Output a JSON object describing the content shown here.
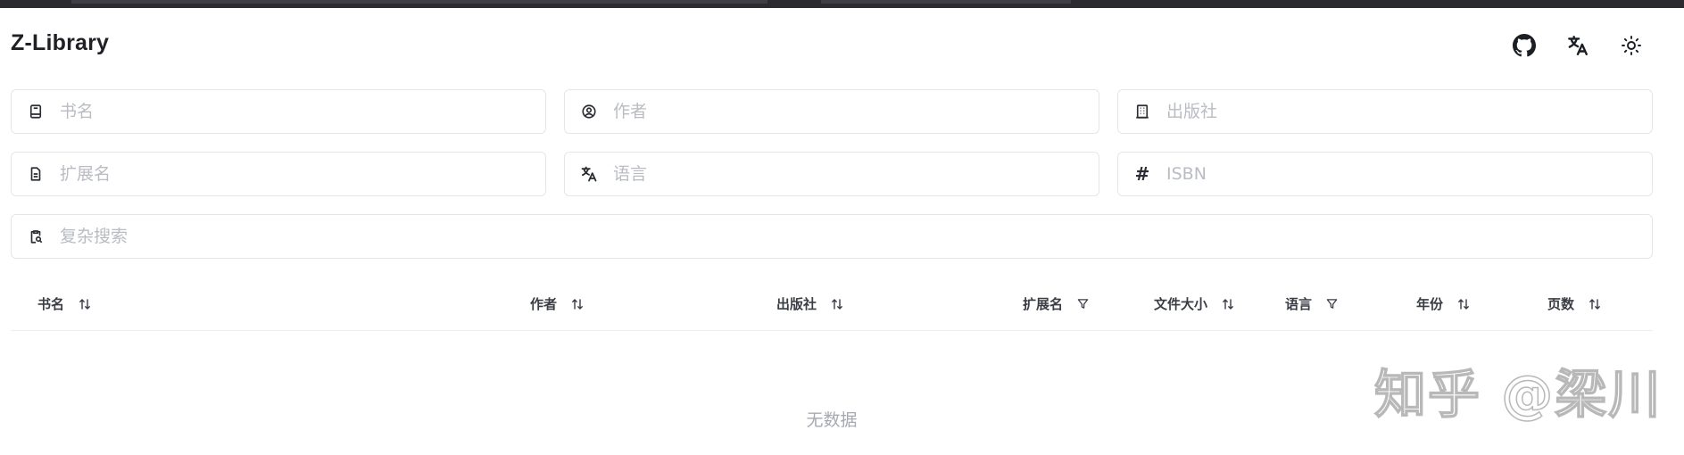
{
  "app": {
    "title": "Z-Library"
  },
  "header": {
    "actions": [
      {
        "name": "github-button",
        "icon": "github-icon"
      },
      {
        "name": "language-button",
        "icon": "translate-icon"
      },
      {
        "name": "theme-toggle-button",
        "icon": "sun-icon"
      }
    ]
  },
  "search": {
    "book_title": {
      "placeholder": "书名",
      "value": "",
      "icon": "book-icon"
    },
    "author": {
      "placeholder": "作者",
      "value": "",
      "icon": "user-circle-icon"
    },
    "publisher": {
      "placeholder": "出版社",
      "value": "",
      "icon": "building-icon"
    },
    "extension": {
      "placeholder": "扩展名",
      "value": "",
      "icon": "file-icon"
    },
    "language": {
      "placeholder": "语言",
      "value": "",
      "icon": "translate-icon"
    },
    "isbn": {
      "placeholder": "ISBN",
      "value": "",
      "icon": "hash-icon",
      "glyph": "#"
    },
    "complex": {
      "placeholder": "复杂搜索",
      "value": "",
      "icon": "clipboard-search-icon"
    }
  },
  "table": {
    "columns": [
      {
        "label": "书名",
        "control": "sort"
      },
      {
        "label": "作者",
        "control": "sort"
      },
      {
        "label": "出版社",
        "control": "sort"
      },
      {
        "label": "扩展名",
        "control": "filter"
      },
      {
        "label": "文件大小",
        "control": "sort"
      },
      {
        "label": "语言",
        "control": "filter"
      },
      {
        "label": "年份",
        "control": "sort"
      },
      {
        "label": "页数",
        "control": "sort"
      }
    ],
    "rows": [],
    "empty_text": "无数据"
  },
  "watermark": {
    "text": "知乎 @梁川"
  },
  "colors": {
    "border": "#e4e6ea",
    "placeholder": "#b9bcc2",
    "text": "#1e2024",
    "topbar": "#2b2b30"
  }
}
